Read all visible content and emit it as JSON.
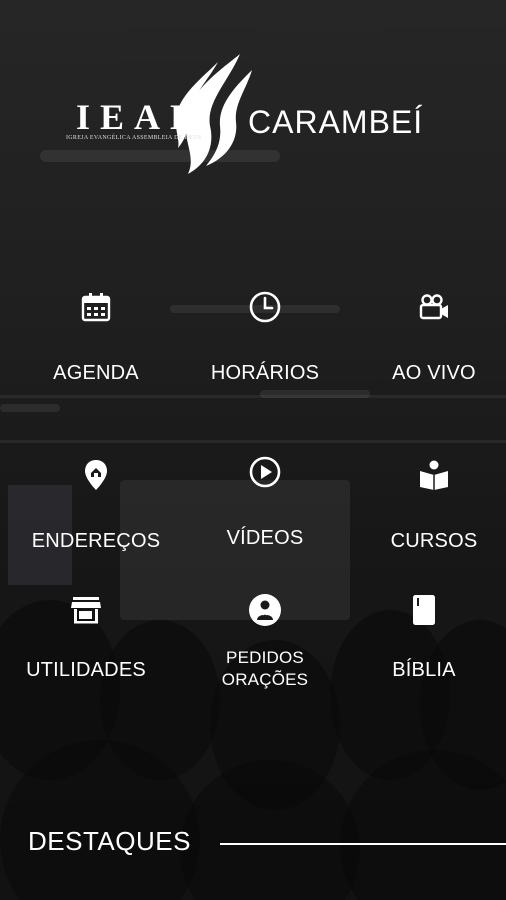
{
  "header": {
    "brand": "IEAD",
    "tagline": "IGREJA EVANGÉLICA ASSEMBLEIA DE DEUS",
    "city": "CARAMBEÍ"
  },
  "menu": [
    {
      "label": "AGENDA",
      "icon": "calendar-icon"
    },
    {
      "label": "HORÁRIOS",
      "icon": "clock-icon"
    },
    {
      "label": "AO VIVO",
      "icon": "video-camera-icon"
    },
    {
      "label": "ENDEREÇOS",
      "icon": "map-pin-icon"
    },
    {
      "label": "VÍDEOS",
      "icon": "play-circle-icon"
    },
    {
      "label": "CURSOS",
      "icon": "book-reader-icon"
    },
    {
      "label": "UTILIDADES",
      "icon": "store-icon"
    },
    {
      "label_line1": "PEDIDOS",
      "label_line2": "ORAÇÕES",
      "icon": "praying-person-icon"
    },
    {
      "label": "BÍBLIA",
      "icon": "bible-icon"
    }
  ],
  "section": {
    "title": "DESTAQUES"
  },
  "colors": {
    "text": "#ffffff",
    "background": "#1a1a1a"
  }
}
